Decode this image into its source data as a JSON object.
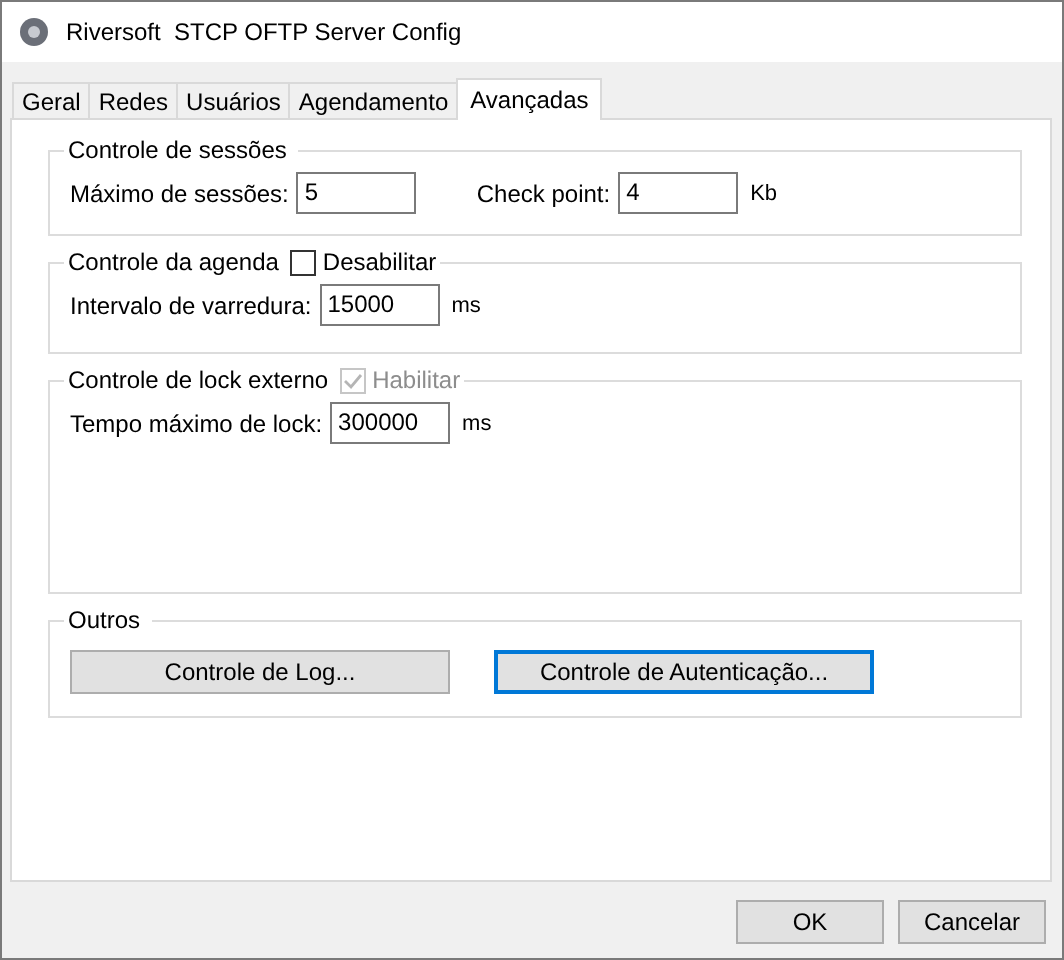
{
  "window": {
    "title": "Riversoft  STCP OFTP Server Config"
  },
  "tabs": [
    {
      "label": "Geral",
      "selected": false
    },
    {
      "label": "Redes",
      "selected": false
    },
    {
      "label": "Usuários",
      "selected": false
    },
    {
      "label": "Agendamento",
      "selected": false
    },
    {
      "label": "Avançadas",
      "selected": true
    }
  ],
  "groups": [
    {
      "kind": "fields",
      "title": "Controle de sessões",
      "fields": [
        {
          "label": "Máximo de sessões:",
          "value": "5"
        },
        {
          "label": "Check point:",
          "value": "4",
          "unit": "Kb"
        }
      ]
    },
    {
      "kind": "fields",
      "title": "Controle da agenda",
      "checkbox": {
        "label": "Desabilitar",
        "checked": false,
        "disabled": false
      },
      "fields": [
        {
          "label": "Intervalo de varredura:",
          "value": "15000",
          "unit": "ms"
        }
      ]
    },
    {
      "kind": "fields",
      "title": "Controle de lock externo",
      "checkbox": {
        "label": "Habilitar",
        "checked": true,
        "disabled": true
      },
      "fields": [
        {
          "label": "Tempo máximo de lock:",
          "value": "300000",
          "unit": "ms"
        }
      ]
    },
    {
      "kind": "buttons",
      "title": "Outros",
      "buttons": [
        {
          "label": "Controle de Log...",
          "focused": false
        },
        {
          "label": "Controle de Autenticação...",
          "focused": true
        }
      ]
    }
  ],
  "buttons": [
    {
      "label": "OK"
    },
    {
      "label": "Cancelar"
    }
  ]
}
